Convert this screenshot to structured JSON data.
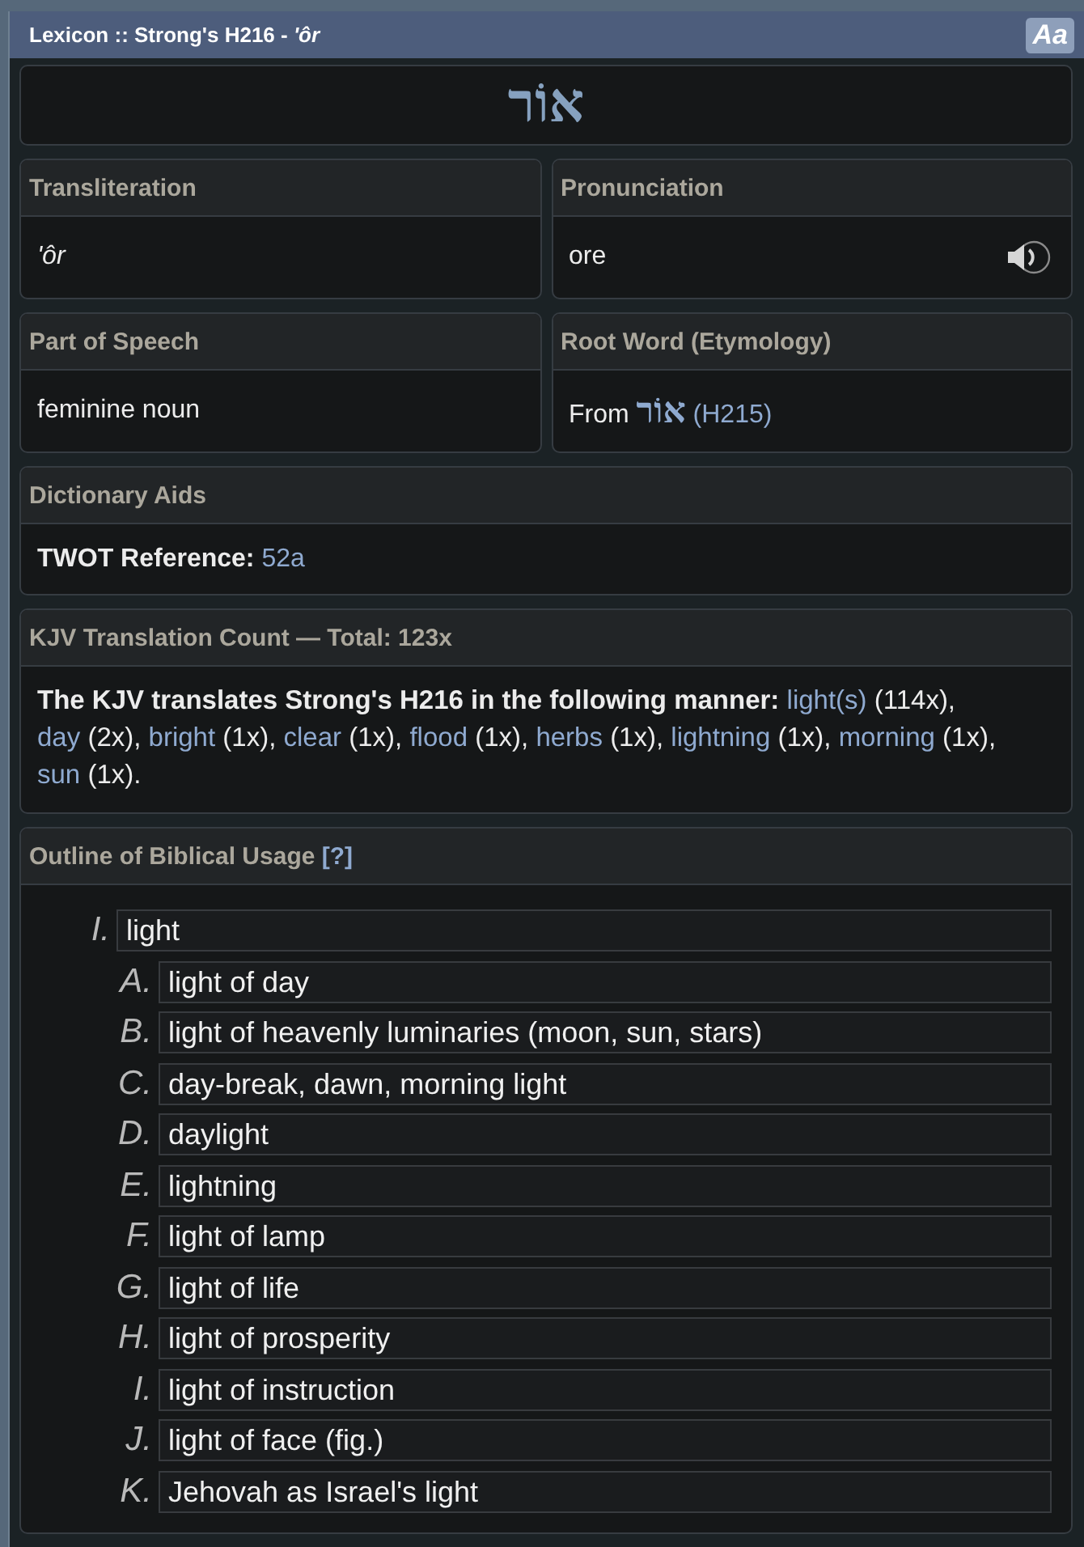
{
  "window": {
    "title": "Lexicon :: Strong's H216 - *'ôr*",
    "font_button": "Aa"
  },
  "headword": "אוֹר",
  "fields": [
    {
      "kind": "transliteration",
      "heading": "Transliteration",
      "value": "'ôr"
    },
    {
      "kind": "pronunciation",
      "heading": "Pronunciation",
      "value": "ore"
    },
    {
      "kind": "text",
      "heading": "Part of Speech",
      "value": "feminine noun"
    },
    {
      "kind": "root",
      "heading": "Root Word (Etymology)",
      "prefix": "From",
      "hebrew": "אוֹר",
      "reference": "(H215)"
    }
  ],
  "dictionary_aids": {
    "heading": "Dictionary Aids",
    "label": "TWOT Reference:",
    "reference": "52a"
  },
  "kjv_translation_count": {
    "heading": "KJV Translation Count — Total: 123x",
    "intro": "The KJV translates Strong's H216 in the following manner:",
    "renderings": [
      {
        "word": "light(s)",
        "count": "(114x),"
      },
      {
        "word": "day",
        "count": "(2x),"
      },
      {
        "word": "bright",
        "count": "(1x),"
      },
      {
        "word": "clear",
        "count": "(1x),"
      },
      {
        "word": "flood",
        "count": "(1x),"
      },
      {
        "word": "herbs",
        "count": "(1x),"
      },
      {
        "word": "lightning",
        "count": "(1x),"
      },
      {
        "word": "morning",
        "count": "(1x),"
      },
      {
        "word": "sun",
        "count": "(1x)."
      }
    ]
  },
  "outline": {
    "heading": "Outline of Biblical Usage",
    "help_link": "[?]",
    "items": [
      {
        "marker": "I.",
        "text": "light",
        "children": [
          {
            "marker": "A.",
            "text": "light of day"
          },
          {
            "marker": "B.",
            "text": "light of heavenly luminaries (moon, sun, stars)"
          },
          {
            "marker": "C.",
            "text": "day-break, dawn, morning light"
          },
          {
            "marker": "D.",
            "text": "daylight"
          },
          {
            "marker": "E.",
            "text": "lightning"
          },
          {
            "marker": "F.",
            "text": "light of lamp"
          },
          {
            "marker": "G.",
            "text": "light of life"
          },
          {
            "marker": "H.",
            "text": "light of prosperity"
          },
          {
            "marker": "I.",
            "text": "light of instruction"
          },
          {
            "marker": "J.",
            "text": "light of face (fig.)"
          },
          {
            "marker": "K.",
            "text": "Jehovah as Israel's light"
          }
        ]
      }
    ]
  }
}
